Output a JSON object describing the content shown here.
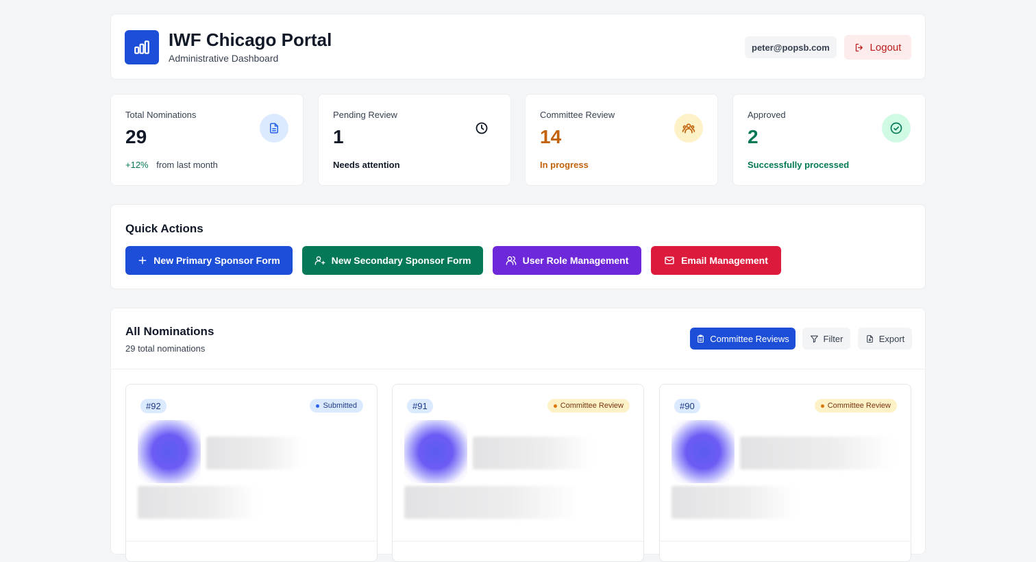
{
  "header": {
    "title": "IWF Chicago Portal",
    "subtitle": "Administrative Dashboard",
    "user_email": "peter@popsb.com",
    "logout_label": "Logout"
  },
  "stats": [
    {
      "label": "Total Nominations",
      "value": "29",
      "delta": "+12%",
      "foot": "from last month",
      "icon": "document-icon"
    },
    {
      "label": "Pending Review",
      "value": "1",
      "foot": "Needs attention",
      "icon": "clock-icon"
    },
    {
      "label": "Committee Review",
      "value": "14",
      "foot": "In progress",
      "icon": "users-group-icon"
    },
    {
      "label": "Approved",
      "value": "2",
      "foot": "Successfully processed",
      "icon": "check-circle-icon"
    }
  ],
  "quick_actions": {
    "title": "Quick Actions",
    "buttons": [
      {
        "label": "New Primary Sponsor Form",
        "icon": "plus-icon",
        "color": "#1d4ed8"
      },
      {
        "label": "New Secondary Sponsor Form",
        "icon": "user-plus-icon",
        "color": "#047857"
      },
      {
        "label": "User Role Management",
        "icon": "users-icon",
        "color": "#6d28d9"
      },
      {
        "label": "Email Management",
        "icon": "mail-icon",
        "color": "#dc1a3c"
      }
    ]
  },
  "nominations": {
    "title": "All Nominations",
    "subtitle": "29 total nominations",
    "committee_reviews_label": "Committee Reviews",
    "filter_label": "Filter",
    "export_label": "Export",
    "items": [
      {
        "id": "#92",
        "status": "Submitted"
      },
      {
        "id": "#91",
        "status": "Committee Review"
      },
      {
        "id": "#90",
        "status": "Committee Review"
      }
    ]
  },
  "colors": {
    "accent_blue": "#1d4ed8",
    "committee_orange": "#c2620a",
    "approved_green": "#047857"
  }
}
